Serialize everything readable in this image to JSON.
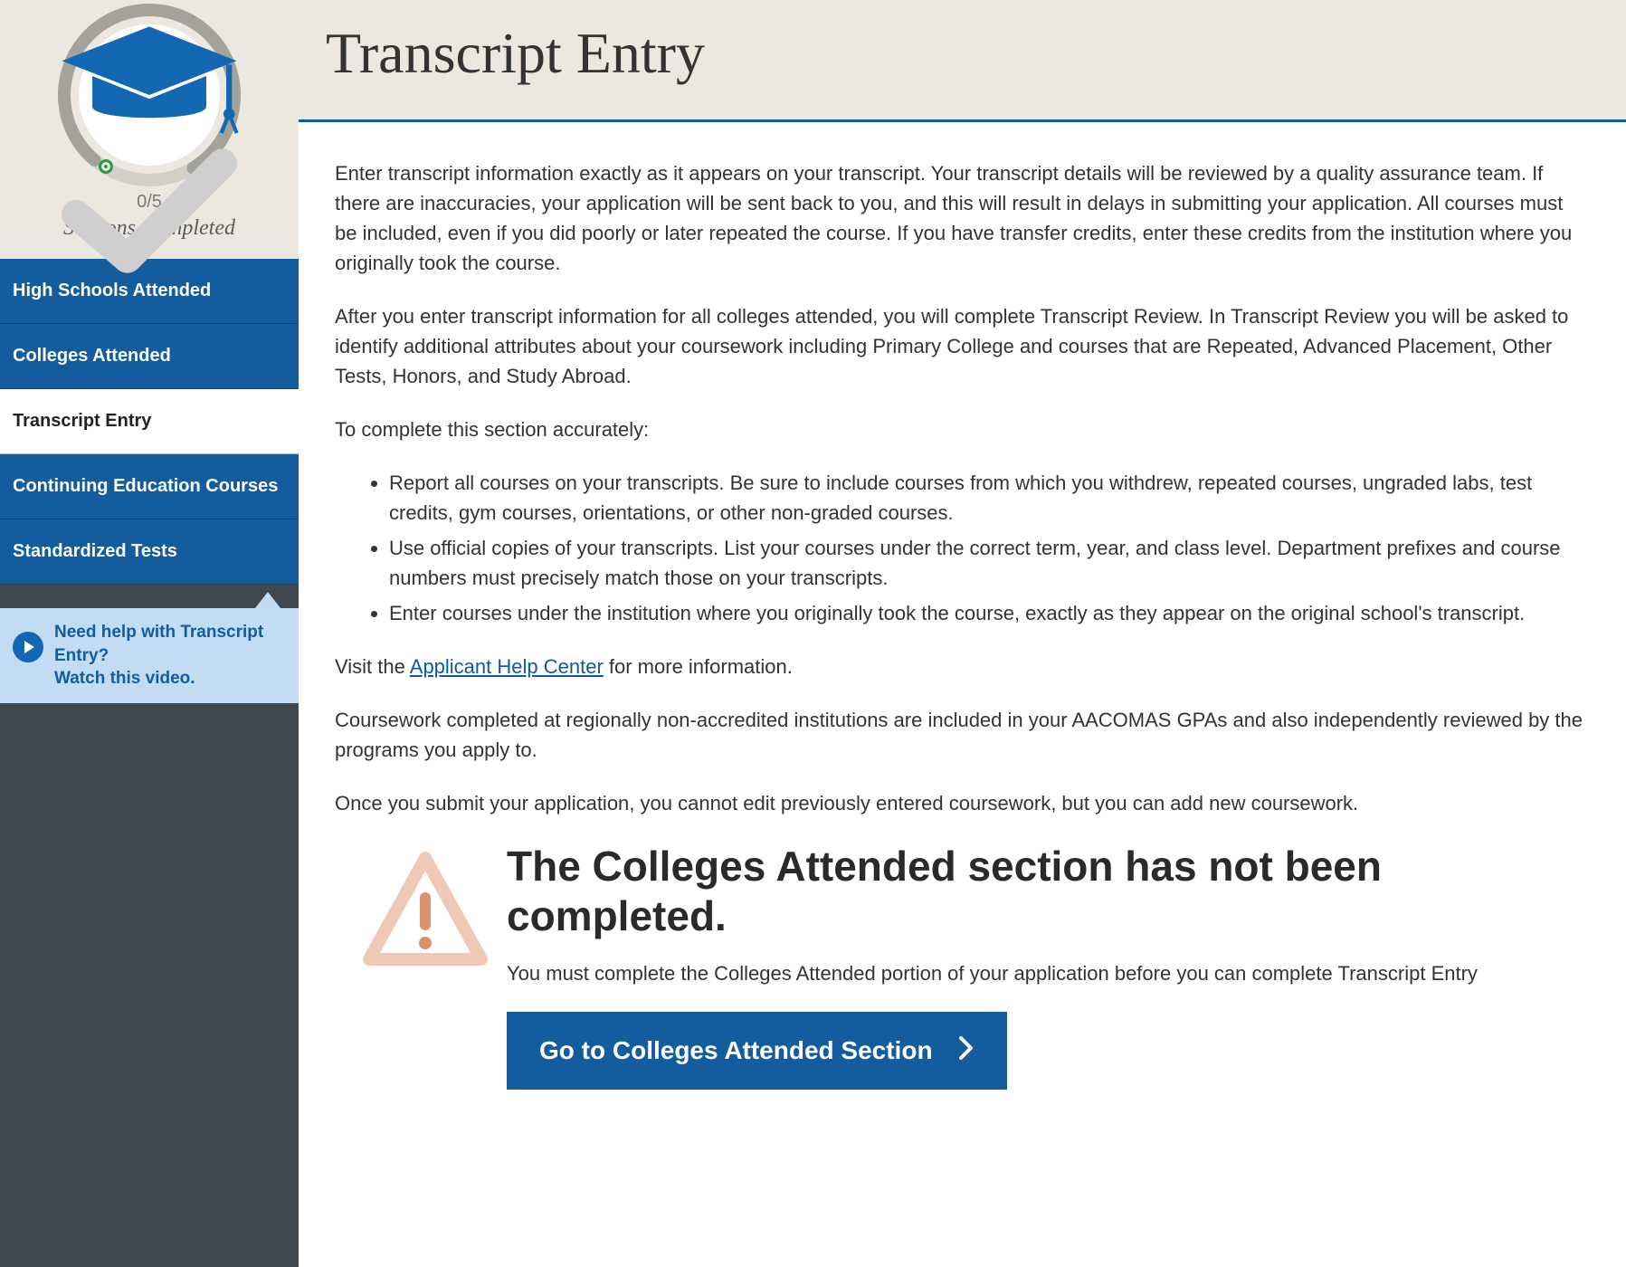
{
  "sidebar": {
    "progress": {
      "count_text": "0/5",
      "label": "Sections Completed"
    },
    "items": [
      {
        "label": "High Schools Attended",
        "state": "blue"
      },
      {
        "label": "Colleges Attended",
        "state": "blue"
      },
      {
        "label": "Transcript Entry",
        "state": "active"
      },
      {
        "label": "Continuing Education Courses",
        "state": "blue"
      },
      {
        "label": "Standardized Tests",
        "state": "blue"
      }
    ],
    "help": {
      "line1": "Need help with Transcript Entry?",
      "line2": "Watch this video."
    }
  },
  "page": {
    "title": "Transcript Entry",
    "para1": "Enter transcript information exactly as it appears on your transcript. Your transcript details will be reviewed by a quality assurance team. If there are inaccuracies, your application will be sent back to you, and this will result in delays in submitting your application. All courses must be included, even if you did poorly or later repeated the course. If you have transfer credits, enter these credits from the institution where you originally took the course.",
    "para2": "After you enter transcript information for all colleges attended, you will complete Transcript Review. In Transcript Review you will be asked to identify additional attributes about your coursework including Primary College and courses that are Repeated, Advanced Placement, Other Tests, Honors, and Study Abroad.",
    "para3": "To complete this section accurately:",
    "bullets": [
      "Report all courses on your transcripts. Be sure to include courses from which you withdrew, repeated courses, ungraded labs, test credits, gym courses, orientations, or other non-graded courses.",
      "Use official copies of your transcripts. List your courses under the correct term, year, and class level. Department prefixes and course numbers must precisely match those on your transcripts.",
      "Enter courses under the institution where you originally took the course, exactly as they appear on the original school's transcript."
    ],
    "visit_prefix": "Visit the ",
    "visit_link": "Applicant Help Center",
    "visit_suffix": " for more information.",
    "para4": "Coursework completed at regionally non-accredited institutions are included in your AACOMAS GPAs and also independently reviewed by the programs you apply to.",
    "para5": "Once you submit your application, you cannot edit previously entered coursework, but you can add new coursework.",
    "alert": {
      "heading": "The Colleges Attended section has not been completed.",
      "sub": "You must complete the Colleges Attended portion of your application before you can complete Transcript Entry",
      "button": "Go to Colleges Attended Section"
    }
  }
}
